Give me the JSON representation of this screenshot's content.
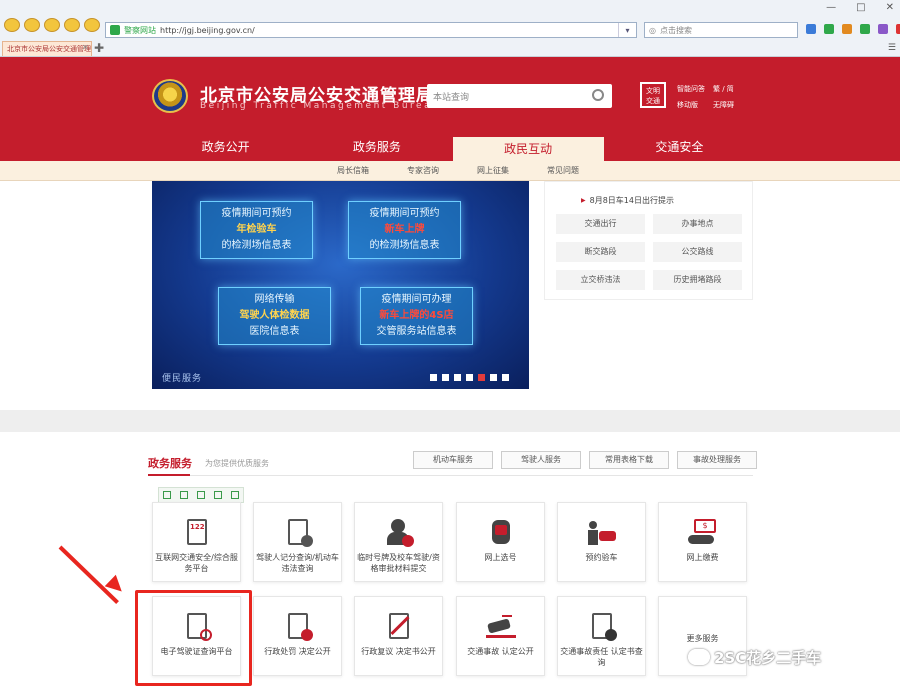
{
  "browser": {
    "url_site_label": "警察网站",
    "url": "http://jgj.beijing.gov.cn/",
    "search_placeholder": "点击搜索",
    "tab_title": "北京市公安局公安交通管理局"
  },
  "header": {
    "title_cn": "北京市公安局公安交通管理局",
    "title_en": "Beijing Traffic Management Bureau",
    "search_placeholder": "本站查询",
    "logo2_text": "文明 交通",
    "links": [
      "智能问答",
      "繁 / 简",
      "移动版",
      "无障碍"
    ]
  },
  "nav": {
    "items": [
      "政务公开",
      "政务服务",
      "政民互动",
      "交通安全"
    ],
    "active": "政民互动"
  },
  "subnav": {
    "items": [
      "局长信箱",
      "专家咨询",
      "网上征集",
      "常见问题"
    ]
  },
  "banner": {
    "cards": [
      {
        "l1": "疫情期间可预约",
        "l2": "年检验车",
        "l3": "的检测场信息表"
      },
      {
        "l1": "疫情期间可预约",
        "l2": "新车上牌",
        "l3": "的检测场信息表"
      },
      {
        "l1": "网络传输",
        "l2": "驾驶人体检数据",
        "l3": "医院信息表"
      },
      {
        "l1": "疫情期间可办理",
        "l2": "新车上牌的4S店",
        "l3": "交管服务站信息表"
      }
    ],
    "caption": "便民服务",
    "dot_count": 7,
    "active_dot": 4
  },
  "right_panel": {
    "notice": "8月8日车14日出行提示",
    "buttons": [
      "交通出行",
      "办事地点",
      "断交路段",
      "公交路线",
      "立交桥违法",
      "历史拥堵路段"
    ]
  },
  "services": {
    "title": "政务服务",
    "subtitle": "为您提供优质服务",
    "tabs": [
      "机动车服务",
      "驾驶人服务",
      "常用表格下载",
      "事故处理服务"
    ],
    "row1": [
      {
        "label": "互联网交通安全/综合服务平台",
        "icon": "122-document-icon"
      },
      {
        "label": "驾驶人记分查询/机动车违法查询",
        "icon": "car-search-icon"
      },
      {
        "label": "临时号牌及校车驾驶/资格审批材料提交",
        "icon": "officer-check-icon"
      },
      {
        "label": "网上选号",
        "icon": "hand-select-icon"
      },
      {
        "label": "预约验车",
        "icon": "person-car-icon"
      },
      {
        "label": "网上缴费",
        "icon": "hand-money-icon"
      }
    ],
    "row2": [
      {
        "label": "电子驾驶证查询平台",
        "icon": "document-search-icon"
      },
      {
        "label": "行政处罚 决定公开",
        "icon": "document-stamp-icon"
      },
      {
        "label": "行政复议 决定书公开",
        "icon": "pen-document-icon"
      },
      {
        "label": "交通事故 认定公开",
        "icon": "car-accident-icon"
      },
      {
        "label": "交通事故责任 认定书查询",
        "icon": "document-magnifier-icon"
      },
      {
        "label": "更多服务",
        "icon": ""
      }
    ]
  },
  "watermark": "2SC花乡二手车",
  "colors": {
    "brand_red": "#c41d2c",
    "annotation_red": "#e8261f",
    "banner_blue": "#143a8f"
  }
}
